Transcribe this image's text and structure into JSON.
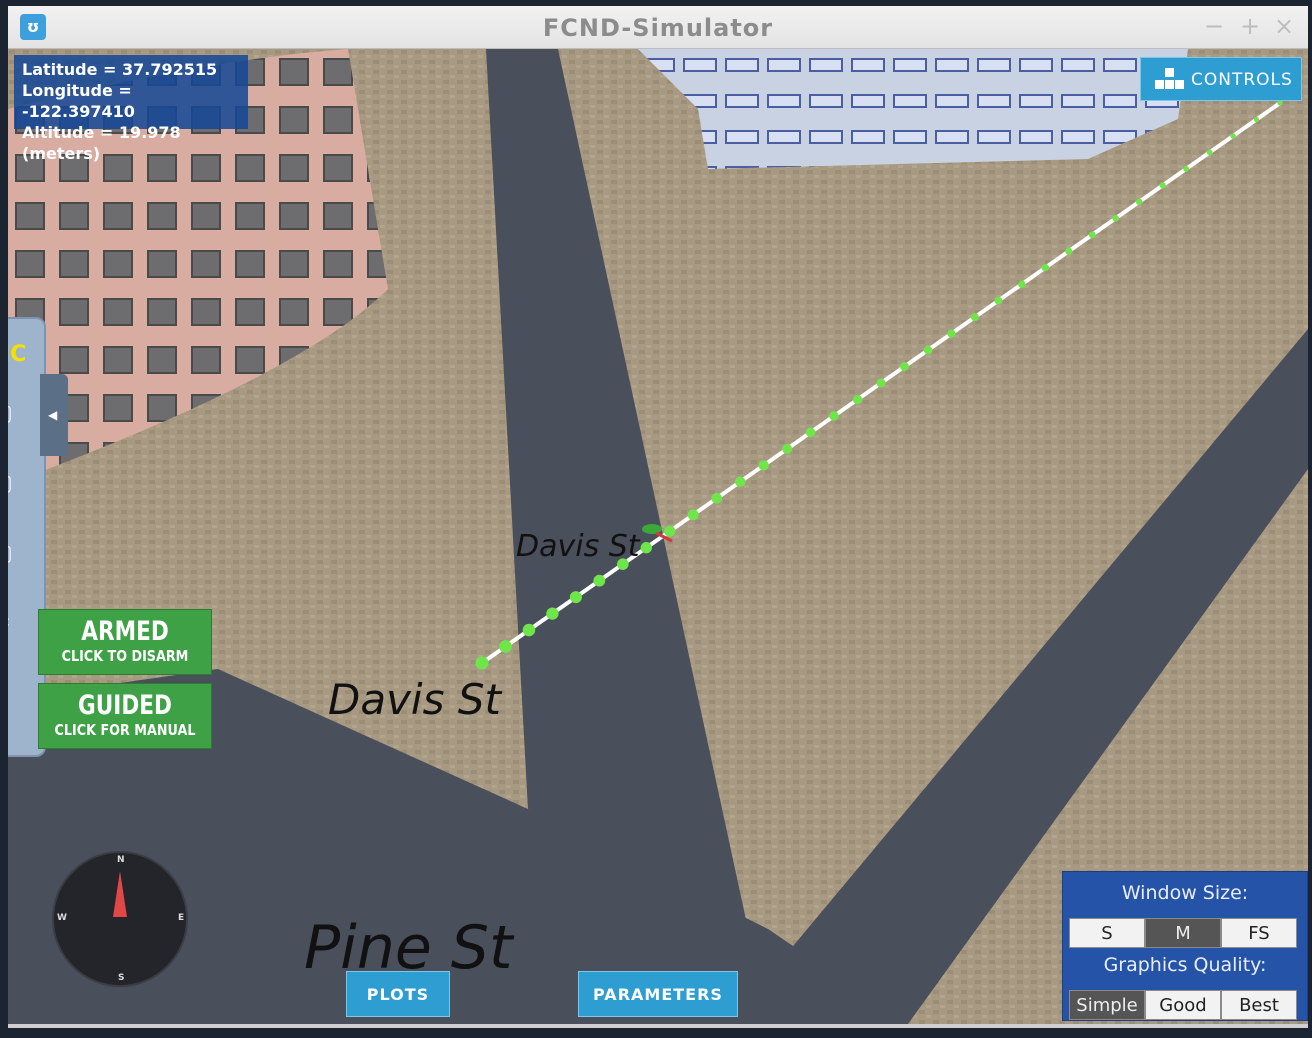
{
  "window": {
    "title": "FCND-Simulator",
    "minimize_glyph": "−",
    "maximize_glyph": "+",
    "close_glyph": "×"
  },
  "telemetry": {
    "latitude": "Latitude = 37.792515",
    "longitude": "Longitude = -122.397410",
    "altitude": "Altitude = 19.978 (meters)"
  },
  "controls_button": {
    "label": "CONTROLS",
    "icon": "controls-keys-icon"
  },
  "side_panel": {
    "tag": "IC",
    "icons": [
      "camera-icon",
      "map-icon",
      "save-icon",
      "gear-icon",
      "help-icon"
    ],
    "collapse_icon": "chevron-left-icon"
  },
  "armed_button": {
    "title": "ARMED",
    "subtitle": "CLICK TO DISARM"
  },
  "guided_button": {
    "title": "GUIDED",
    "subtitle": "CLICK FOR MANUAL"
  },
  "compass": {
    "n": "N",
    "s": "S",
    "e": "E",
    "w": "W"
  },
  "streets": {
    "label_center": "Davis St",
    "label_left": "Davis St",
    "label_bottom": "Pine St"
  },
  "bottom_buttons": {
    "plots": "PLOTS",
    "parameters": "PARAMETERS"
  },
  "settings_panel": {
    "window_size_label": "Window Size:",
    "window_size_options": [
      "S",
      "M",
      "FS"
    ],
    "window_size_selected": "M",
    "graphics_quality_label": "Graphics Quality:",
    "graphics_quality_options": [
      "Simple",
      "Good",
      "Best"
    ],
    "graphics_quality_selected": "Simple"
  },
  "colors": {
    "ground": "#a89a82",
    "road": "#4a4f5c",
    "path_line": "#ffffff",
    "waypoint": "#6ee64a",
    "armed_green": "#3fa146",
    "accent_blue": "#2e9ed2",
    "panel_blue": "#2553a8"
  }
}
